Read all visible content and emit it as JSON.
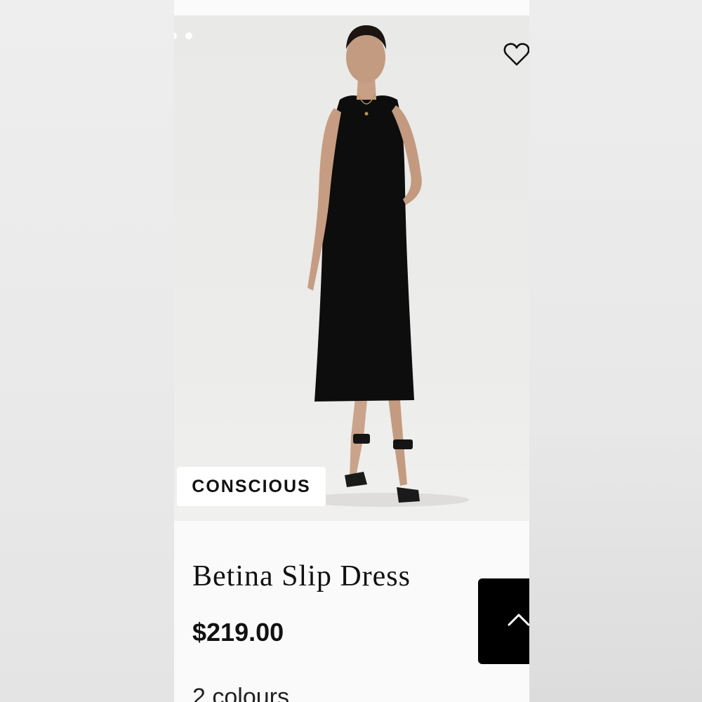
{
  "product": {
    "badge": "CONSCIOUS",
    "title": "Betina Slip Dress",
    "price": "$219.00",
    "colours": "2 colours",
    "image_icon": "model-in-black-halter-midi-dress"
  },
  "carousel": {
    "dot_count": 2
  },
  "icons": {
    "wishlist": "heart-outline-icon",
    "scroll_top": "chevron-up-icon"
  },
  "colors": {
    "text": "#111111",
    "dress": "#0d0d0d",
    "button": "#000000",
    "background": "#fafafa"
  }
}
